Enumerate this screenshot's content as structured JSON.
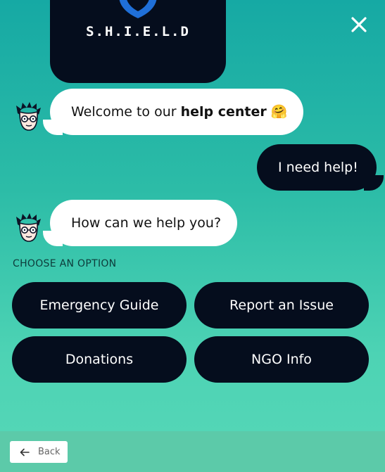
{
  "logo": {
    "text": "S.H.I.E.L.D",
    "icon": "shield-icon"
  },
  "header": {
    "close_icon": "close-icon"
  },
  "messages": [
    {
      "from": "bot",
      "text_before": "Welcome to our ",
      "text_bold": "help center",
      "emoji": "🤗"
    },
    {
      "from": "user",
      "text": "I need help!"
    },
    {
      "from": "bot",
      "text": "How can we help you?"
    }
  ],
  "choose_label": "CHOOSE AN OPTION",
  "options": [
    {
      "label": "Emergency Guide"
    },
    {
      "label": "Report an Issue"
    },
    {
      "label": "Donations"
    },
    {
      "label": "NGO Info"
    }
  ],
  "footer": {
    "back_label": "Back",
    "back_icon": "arrow-left-icon"
  },
  "colors": {
    "accent_dark": "#050d1d",
    "bg_top": "#16a9a4",
    "bg_bottom": "#56d7b7",
    "shield_blue": "#1f6fd8"
  }
}
